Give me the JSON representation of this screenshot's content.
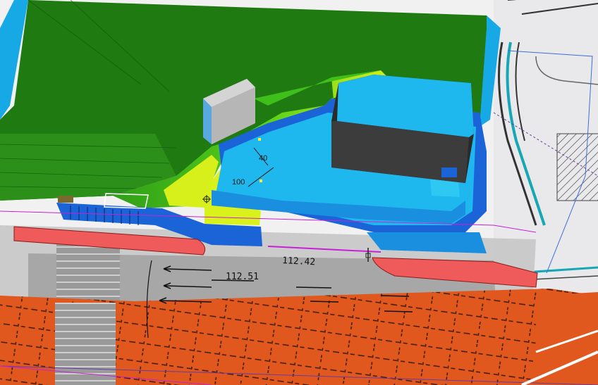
{
  "scene": {
    "labels": {
      "dim_40": "40",
      "dim_100": "100",
      "elev_1": "112.42",
      "elev_2": "112.51"
    },
    "colors": {
      "terrain_green": "#1f7a12",
      "slope_green": "#3fbf1a",
      "slope_yellow": "#d7ef1a",
      "building_cyan": "#18b8ec",
      "building_dark": "#3a3a3a",
      "curb_blue": "#1a64d8",
      "footpath_red": "#ef5b5b",
      "road_gray": "#8d8d8d",
      "plan_orange": "#e0581d",
      "guide_magenta": "#c81fd8"
    },
    "icons": [
      "survey-point-icon",
      "elevation-marker-icon"
    ]
  }
}
